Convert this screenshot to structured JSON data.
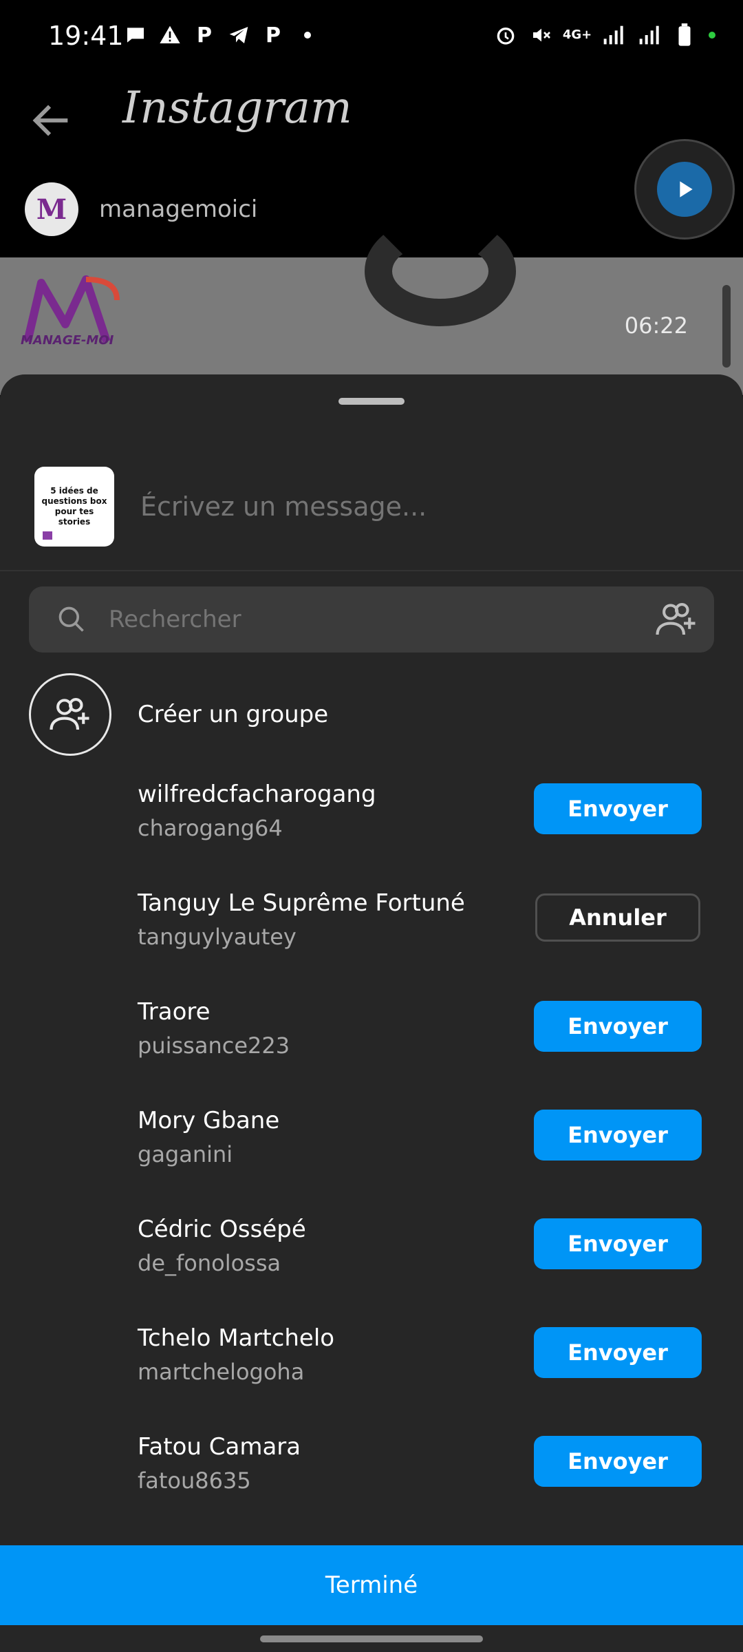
{
  "status": {
    "time": "19:41",
    "network": "4G+",
    "left_icons": [
      "message-icon",
      "warning-icon",
      "p-icon",
      "telegram-icon",
      "p-icon",
      "dot-icon"
    ],
    "right_icons": [
      "alarm-icon",
      "mute-icon",
      "network-4g-icon",
      "signal-icon",
      "signal-icon",
      "battery-icon"
    ]
  },
  "header": {
    "brand": "Instagram",
    "profile_name": "managemoici"
  },
  "story": {
    "logo_text": "MANAGE-MOI",
    "time": "06:22"
  },
  "sheet": {
    "thumb_text": "5 idées de questions box pour tes stories",
    "message_placeholder": "Écrivez un message...",
    "search_placeholder": "Rechercher",
    "create_group_label": "Créer un groupe",
    "contacts": [
      {
        "name": "wilfredcfacharogang",
        "username": "charogang64",
        "action": "Envoyer"
      },
      {
        "name": "Tanguy Le Suprême Fortuné",
        "username": "tanguylyautey",
        "action": "Annuler"
      },
      {
        "name": "Traore",
        "username": "puissance223",
        "action": "Envoyer"
      },
      {
        "name": "Mory Gbane",
        "username": "gaganini",
        "action": "Envoyer"
      },
      {
        "name": "Cédric Ossépé",
        "username": "de_fonolossa",
        "action": "Envoyer"
      },
      {
        "name": "Tchelo Martchelo",
        "username": "martchelogoha",
        "action": "Envoyer"
      },
      {
        "name": "Fatou Camara",
        "username": "fatou8635",
        "action": "Envoyer"
      }
    ],
    "done_label": "Terminé"
  },
  "colors": {
    "accent": "#0095f6",
    "sheet_bg": "#262626",
    "field_bg": "#3b3b3b"
  }
}
